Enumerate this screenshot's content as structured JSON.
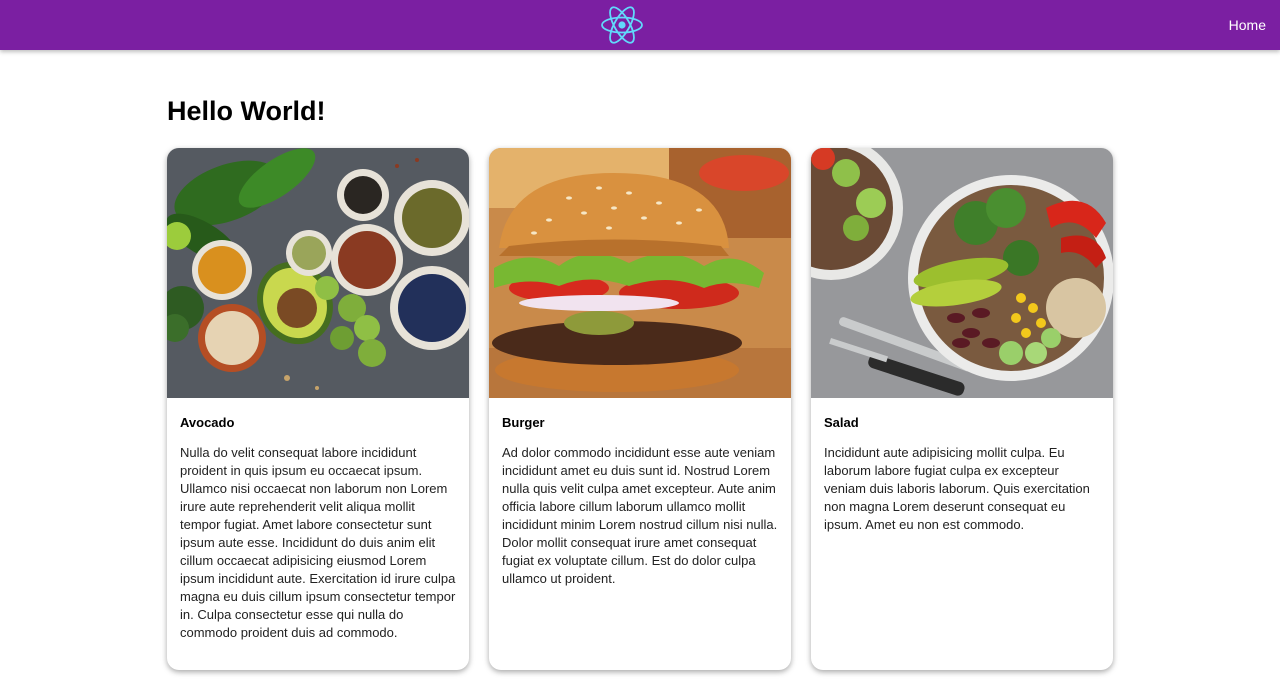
{
  "nav": {
    "home_label": "Home",
    "logo_icon": "react-logo-icon",
    "bg_color": "#7b1fa2"
  },
  "page": {
    "title": "Hello World!"
  },
  "cards": [
    {
      "title": "Avocado",
      "image": "avocado-spread-image",
      "text": "Nulla do velit consequat labore incididunt proident in quis ipsum eu occaecat ipsum. Ullamco nisi occaecat non laborum non Lorem irure aute reprehenderit velit aliqua mollit tempor fugiat. Amet labore consectetur sunt ipsum aute esse. Incididunt do duis anim elit cillum occaecat adipisicing eiusmod Lorem ipsum incididunt aute. Exercitation id irure culpa magna eu duis cillum ipsum consectetur tempor in. Culpa consectetur esse qui nulla do commodo proident duis ad commodo."
    },
    {
      "title": "Burger",
      "image": "burger-image",
      "text": "Ad dolor commodo incididunt esse aute veniam incididunt amet eu duis sunt id. Nostrud Lorem nulla quis velit culpa amet excepteur. Aute anim officia labore cillum laborum ullamco mollit incididunt minim Lorem nostrud cillum nisi nulla. Dolor mollit consequat irure amet consequat fugiat ex voluptate cillum. Est do dolor culpa ullamco ut proident."
    },
    {
      "title": "Salad",
      "image": "salad-bowl-image",
      "text": "Incididunt aute adipisicing mollit culpa. Eu laborum labore fugiat culpa ex excepteur veniam duis laboris laborum. Quis exercitation non magna Lorem deserunt consequat eu ipsum. Amet eu non est commodo."
    }
  ]
}
